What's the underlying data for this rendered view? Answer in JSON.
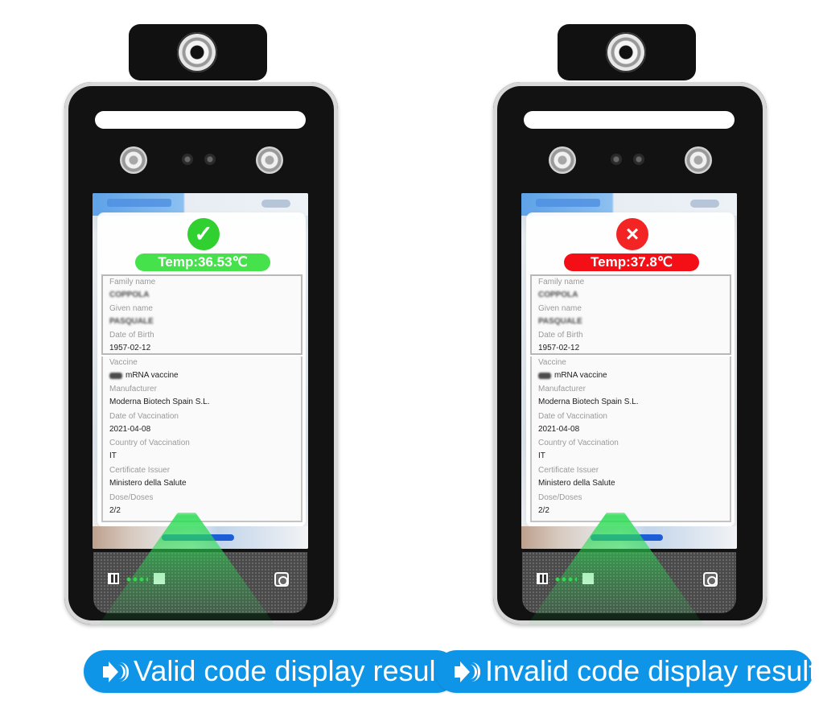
{
  "devices": {
    "left": {
      "temp": "Temp:36.53℃",
      "family_label": "Family name",
      "family_value": "COPPOLA",
      "given_label": "Given name",
      "given_value": "PASQUALE",
      "birth_label": "Date of Birth",
      "birth_value": "1957-02-12",
      "vaccine_label": "Vaccine",
      "vaccine_value": "mRNA vaccine",
      "manufacturer_label": "Manufacturer",
      "manufacturer_value": "Moderna Biotech Spain S.L.",
      "vaccination_date_label": "Date of Vaccination",
      "vaccination_date_value": "2021-04-08",
      "country_label": "Country of Vaccination",
      "country_value": "IT",
      "issuer_label": "Certificate Issuer",
      "issuer_value": "Ministero della Salute",
      "doses_label": "Dose/Doses",
      "doses_value": "2/2",
      "caption": "Valid code display result"
    },
    "right": {
      "temp": "Temp:37.8℃",
      "family_label": "Family name",
      "family_value": "COPPOLA",
      "given_label": "Given name",
      "given_value": "PASQUALE",
      "birth_label": "Date of Birth",
      "birth_value": "1957-02-12",
      "vaccine_label": "Vaccine",
      "vaccine_value": "mRNA vaccine",
      "manufacturer_label": "Manufacturer",
      "manufacturer_value": "Moderna Biotech Spain S.L.",
      "vaccination_date_label": "Date of Vaccination",
      "vaccination_date_value": "2021-04-08",
      "country_label": "Country of Vaccination",
      "country_value": "IT",
      "issuer_label": "Certificate Issuer",
      "issuer_value": "Ministero della Salute",
      "doses_label": "Dose/Doses",
      "doses_value": "2/2",
      "caption": "Invalid code display result"
    }
  },
  "status": {
    "valid_icon": "check-circle-icon",
    "invalid_icon": "x-circle-icon",
    "valid_color": "#2fd02f",
    "invalid_color": "#f22424",
    "caption_color": "#0f95e8"
  }
}
